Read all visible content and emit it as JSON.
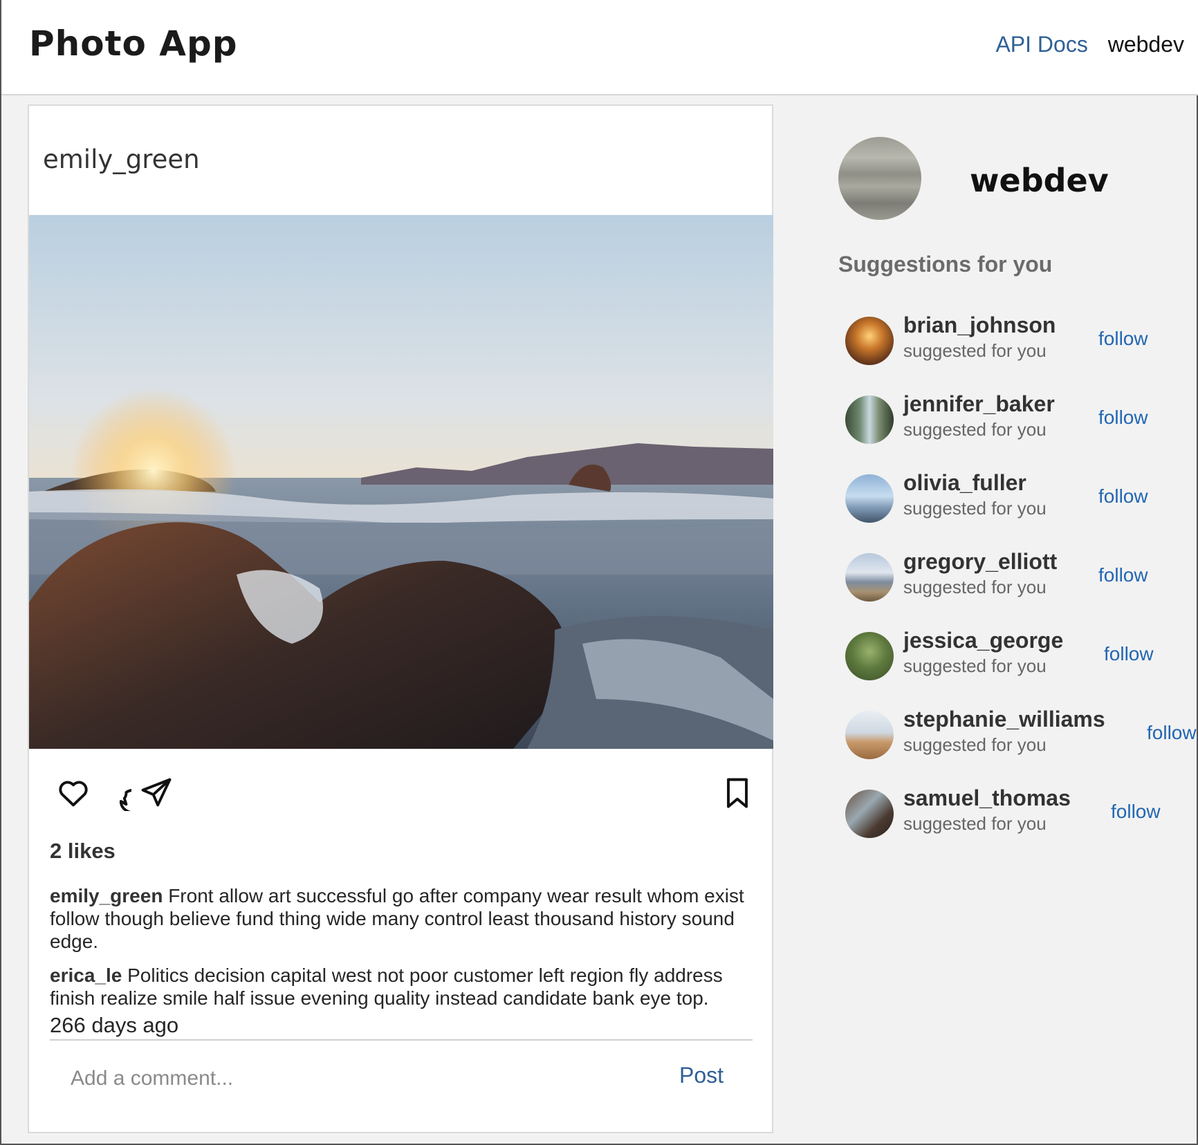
{
  "header": {
    "app_title": "Photo App",
    "api_docs_label": "API Docs",
    "username": "webdev"
  },
  "post": {
    "author": "emily_green",
    "likes": "2 likes",
    "caption": {
      "user": "emily_green",
      "text": "Front allow art successful go after company wear result whom exist follow though believe fund thing wide many control least thousand history sound edge."
    },
    "comments": [
      {
        "user": "erica_le",
        "text": "Politics decision capital west not poor customer left region fly address finish realize smile half issue evening quality instead candidate bank eye top."
      }
    ],
    "timestamp": "266 days ago",
    "comment_placeholder": "Add a comment...",
    "post_label": "Post",
    "icons": [
      "heart-icon",
      "comment-icon",
      "send-icon",
      "bookmark-icon"
    ]
  },
  "sidebar": {
    "profile_name": "webdev",
    "suggestions_heading": "Suggestions for you",
    "suggestions": [
      {
        "name": "brian_johnson",
        "subtitle": "suggested for you",
        "action": "follow"
      },
      {
        "name": "jennifer_baker",
        "subtitle": "suggested for you",
        "action": "follow"
      },
      {
        "name": "olivia_fuller",
        "subtitle": "suggested for you",
        "action": "follow"
      },
      {
        "name": "gregory_elliott",
        "subtitle": "suggested for you",
        "action": "follow"
      },
      {
        "name": "jessica_george",
        "subtitle": "suggested for you",
        "action": "follow"
      },
      {
        "name": "stephanie_williams",
        "subtitle": "suggested for you",
        "action": "follow"
      },
      {
        "name": "samuel_thomas",
        "subtitle": "suggested for you",
        "action": "follow"
      }
    ]
  },
  "colors": {
    "link": "#2f6096",
    "follow": "#2266b3",
    "background": "#f2f2f2"
  }
}
